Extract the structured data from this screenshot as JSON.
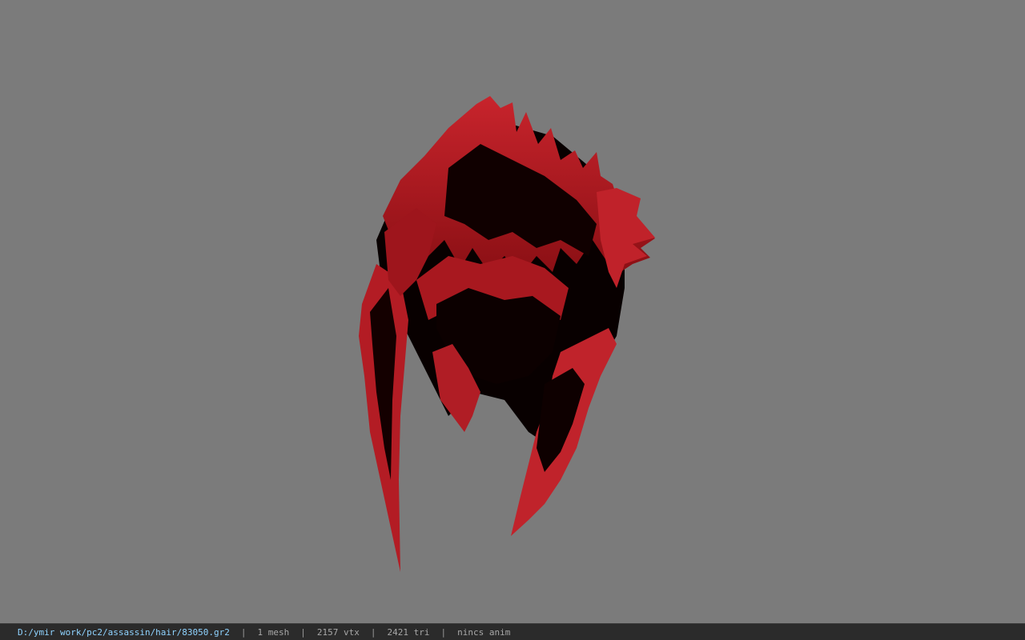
{
  "viewport": {
    "background_color": "#7b7b7b",
    "model": {
      "name": "hair-mesh",
      "primary_color": "#c0222a",
      "shadow_color": "#0a0000"
    }
  },
  "statusbar": {
    "file_path": "D:/ymir work/pc2/assassin/hair/83050.gr2",
    "separator": "|",
    "mesh_count": "1 mesh",
    "vertex_count": "2157 vtx",
    "triangle_count": "2421 tri",
    "anim_status": "nincs anim",
    "path_color": "#8fd3ff",
    "background_color": "#2b2b2b"
  }
}
